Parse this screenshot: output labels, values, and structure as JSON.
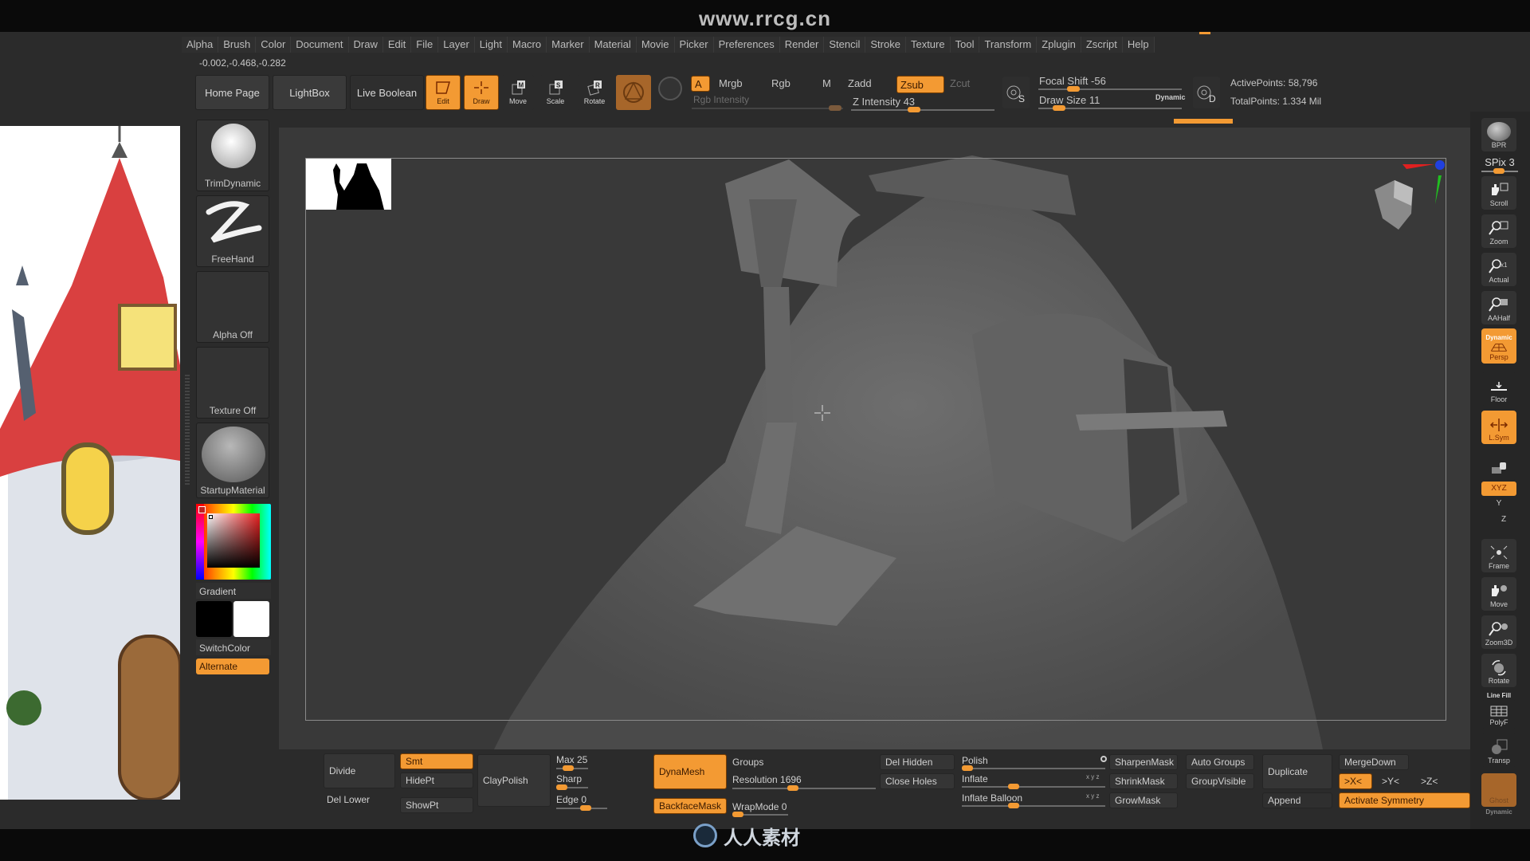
{
  "watermark": {
    "site": "www.rrcg.cn",
    "bottom_logo": "人人素材"
  },
  "menu": [
    "Alpha",
    "Brush",
    "Color",
    "Document",
    "Draw",
    "Edit",
    "File",
    "Layer",
    "Light",
    "Macro",
    "Marker",
    "Material",
    "Movie",
    "Picker",
    "Preferences",
    "Render",
    "Stencil",
    "Stroke",
    "Texture",
    "Tool",
    "Transform",
    "Zplugin",
    "Zscript",
    "Help"
  ],
  "coords": "-0.002,-0.468,-0.282",
  "toolbar": {
    "home_page": "Home Page",
    "lightbox": "LightBox",
    "live_boolean": "Live Boolean",
    "edit": "Edit",
    "draw": "Draw",
    "move": "Move",
    "scale": "Scale",
    "rotate": "Rotate",
    "a": "A",
    "mrgb": "Mrgb",
    "rgb": "Rgb",
    "m": "M",
    "zadd": "Zadd",
    "zsub": "Zsub",
    "zcut": "Zcut",
    "rgb_intensity": "Rgb Intensity",
    "z_intensity": "Z Intensity 43",
    "z_intensity_value": 43,
    "focal_shift": "Focal Shift -56",
    "focal_shift_value": -56,
    "draw_size": "Draw Size 11",
    "draw_size_value": 11,
    "dynamic": "Dynamic",
    "s": "S",
    "d": "D",
    "active_points": "ActivePoints: 58,796",
    "total_points": "TotalPoints: 1.334 Mil"
  },
  "left_shelf": {
    "brush": "TrimDynamic",
    "stroke": "FreeHand",
    "alpha": "Alpha Off",
    "texture": "Texture Off",
    "material": "StartupMaterial",
    "gradient": "Gradient",
    "switch_color": "SwitchColor",
    "alternate": "Alternate",
    "main_color": "#ffffff",
    "secondary_color": "#000000"
  },
  "right_shelf": {
    "bpr": "BPR",
    "spix": "SPix 3",
    "scroll": "Scroll",
    "zoom": "Zoom",
    "actual": "Actual",
    "aahalf": "AAHalf",
    "persp_dynamic": "Dynamic",
    "persp": "Persp",
    "floor": "Floor",
    "lsym": "L.Sym",
    "xyz": "XYZ",
    "y": "Y",
    "z": "Z",
    "frame": "Frame",
    "move": "Move",
    "zoom3d": "Zoom3D",
    "rotate": "Rotate",
    "line_fill": "Line Fill",
    "polyf": "PolyF",
    "transp": "Transp",
    "ghost": "Ghost",
    "dynamic": "Dynamic"
  },
  "bottom": {
    "divide": "Divide",
    "smt": "Smt",
    "hidept": "HidePt",
    "showpt": "ShowPt",
    "del_lower": "Del Lower",
    "claypolish": "ClayPolish",
    "max": "Max 25",
    "sharp": "Sharp",
    "edge": "Edge 0",
    "dynamesh": "DynaMesh",
    "backfacemask": "BackfaceMask",
    "groups": "Groups",
    "resolution": "Resolution 1696",
    "resolution_value": 1696,
    "wrapmode": "WrapMode 0",
    "del_hidden": "Del Hidden",
    "close_holes": "Close Holes",
    "polish": "Polish",
    "inflate": "Inflate",
    "inflate_balloon": "Inflate Balloon",
    "xyz_small": "x y z",
    "sharpenmask": "SharpenMask",
    "shrinkmask": "ShrinkMask",
    "growmask": "GrowMask",
    "auto_groups": "Auto Groups",
    "groupvisible": "GroupVisible",
    "duplicate": "Duplicate",
    "append": "Append",
    "mergedown": "MergeDown",
    "x_sym": ">X<",
    "y_sym": ">Y<",
    "z_sym": ">Z<",
    "activate_symmetry": "Activate Symmetry"
  }
}
